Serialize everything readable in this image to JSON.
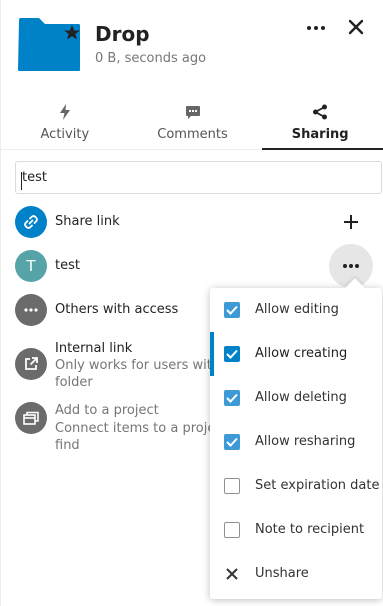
{
  "header": {
    "title": "Drop",
    "subtitle": "0 B, seconds ago"
  },
  "tabs": [
    {
      "label": "Activity",
      "icon": "lightning-icon"
    },
    {
      "label": "Comments",
      "icon": "speech-bubble-icon"
    },
    {
      "label": "Sharing",
      "icon": "share-icon",
      "active": true
    }
  ],
  "search": {
    "value": "test",
    "placeholder": ""
  },
  "share_link": {
    "label": "Share link"
  },
  "share_user": {
    "initial": "T",
    "name": "test",
    "avatar_color": "#56a4a7"
  },
  "others": {
    "label": "Others with access"
  },
  "internal_link": {
    "label": "Internal link",
    "description_line1": "Only works for users with",
    "description_line2": "folder"
  },
  "project": {
    "label": "Add to a project",
    "description_line1": "Connect items to a project",
    "description_line2": "find"
  },
  "menu": {
    "items": [
      {
        "label": "Allow editing",
        "checked": true
      },
      {
        "label": "Allow creating",
        "checked": true,
        "active": true
      },
      {
        "label": "Allow deleting",
        "checked": true
      },
      {
        "label": "Allow resharing",
        "checked": true
      },
      {
        "label": "Set expiration date",
        "checked": false
      },
      {
        "label": "Note to recipient",
        "checked": false
      },
      {
        "label": "Unshare",
        "icon": "close-icon"
      }
    ]
  },
  "colors": {
    "primary": "#0082c9",
    "checkbox": "#3e9ad7",
    "folder": "#0082c9",
    "grey_avatar": "#6b6b6b"
  }
}
